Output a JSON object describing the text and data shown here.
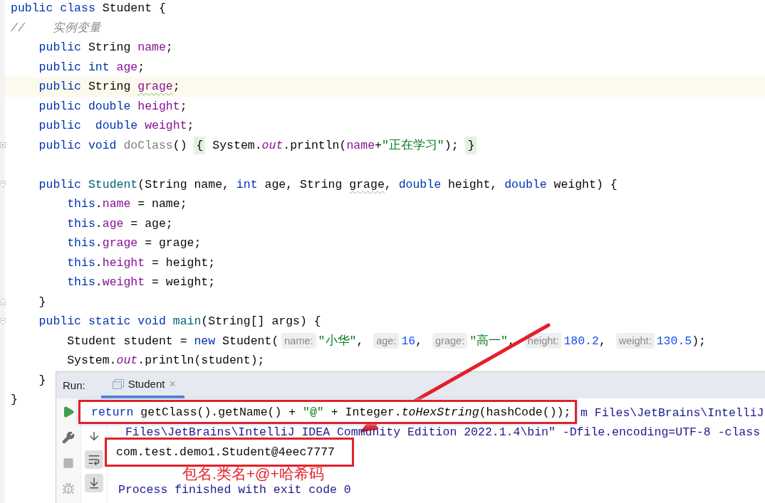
{
  "editor": {
    "lines": [
      {
        "kind": "plain",
        "highlighted": false,
        "tokens": [
          {
            "kind": "keyword",
            "text": "public class "
          },
          {
            "kind": "plain",
            "text": "Student {"
          }
        ]
      },
      {
        "kind": "plain",
        "highlighted": false,
        "tokens": [
          {
            "kind": "comment",
            "text": "//    实例变量"
          }
        ]
      },
      {
        "kind": "plain",
        "highlighted": false,
        "tokens": [
          {
            "kind": "keyword",
            "text": "    public "
          },
          {
            "kind": "plain",
            "text": "String "
          },
          {
            "kind": "field",
            "text": "name"
          },
          {
            "kind": "plain",
            "text": ";"
          }
        ]
      },
      {
        "kind": "plain",
        "highlighted": false,
        "tokens": [
          {
            "kind": "keyword",
            "text": "    public int "
          },
          {
            "kind": "field",
            "text": "age"
          },
          {
            "kind": "plain",
            "text": ";"
          }
        ]
      },
      {
        "kind": "plain",
        "highlighted": true,
        "tokens": [
          {
            "kind": "keyword",
            "text": "    public "
          },
          {
            "kind": "plain",
            "text": "String "
          },
          {
            "kind": "typo-field",
            "text": "grage"
          },
          {
            "kind": "plain",
            "text": ";"
          }
        ]
      },
      {
        "kind": "plain",
        "highlighted": false,
        "tokens": [
          {
            "kind": "keyword",
            "text": "    public double "
          },
          {
            "kind": "field",
            "text": "height"
          },
          {
            "kind": "plain",
            "text": ";"
          }
        ]
      },
      {
        "kind": "plain",
        "highlighted": false,
        "tokens": [
          {
            "kind": "keyword",
            "text": "    public  double "
          },
          {
            "kind": "field",
            "text": "weight"
          },
          {
            "kind": "plain",
            "text": ";"
          }
        ]
      },
      {
        "kind": "folded",
        "highlighted": false,
        "tokens": [
          {
            "kind": "keyword",
            "text": "    public void "
          },
          {
            "kind": "unused",
            "text": "doClass"
          },
          {
            "kind": "plain",
            "text": "() "
          },
          {
            "kind": "brace",
            "text": "{"
          },
          {
            "kind": "plain",
            "text": " System."
          },
          {
            "kind": "static",
            "text": "out"
          },
          {
            "kind": "plain",
            "text": ".println("
          },
          {
            "kind": "field",
            "text": "name"
          },
          {
            "kind": "plain",
            "text": "+"
          },
          {
            "kind": "string",
            "text": "\"正在学习\""
          },
          {
            "kind": "plain",
            "text": "); "
          },
          {
            "kind": "brace",
            "text": "}"
          }
        ]
      },
      {
        "kind": "plain",
        "highlighted": false
      },
      {
        "kind": "fold-start",
        "highlighted": false,
        "tokens": [
          {
            "kind": "keyword",
            "text": "    public "
          },
          {
            "kind": "declaration",
            "text": "Student"
          },
          {
            "kind": "plain",
            "text": "(String name, "
          },
          {
            "kind": "keyword",
            "text": "int"
          },
          {
            "kind": "plain",
            "text": " age, String "
          },
          {
            "kind": "typo",
            "text": "grage"
          },
          {
            "kind": "plain",
            "text": ", "
          },
          {
            "kind": "keyword",
            "text": "double"
          },
          {
            "kind": "plain",
            "text": " height, "
          },
          {
            "kind": "keyword",
            "text": "double"
          },
          {
            "kind": "plain",
            "text": " weight) {"
          }
        ]
      },
      {
        "kind": "plain",
        "highlighted": false,
        "tokens": [
          {
            "kind": "keyword",
            "text": "        this"
          },
          {
            "kind": "plain",
            "text": "."
          },
          {
            "kind": "field",
            "text": "name"
          },
          {
            "kind": "plain",
            "text": " = name;"
          }
        ]
      },
      {
        "kind": "plain",
        "highlighted": false,
        "tokens": [
          {
            "kind": "keyword",
            "text": "        this"
          },
          {
            "kind": "plain",
            "text": "."
          },
          {
            "kind": "field",
            "text": "age"
          },
          {
            "kind": "plain",
            "text": " = age;"
          }
        ]
      },
      {
        "kind": "plain",
        "highlighted": false,
        "tokens": [
          {
            "kind": "keyword",
            "text": "        this"
          },
          {
            "kind": "plain",
            "text": "."
          },
          {
            "kind": "field",
            "text": "grage"
          },
          {
            "kind": "plain",
            "text": " = grage;"
          }
        ]
      },
      {
        "kind": "plain",
        "highlighted": false,
        "tokens": [
          {
            "kind": "keyword",
            "text": "        this"
          },
          {
            "kind": "plain",
            "text": "."
          },
          {
            "kind": "field",
            "text": "height"
          },
          {
            "kind": "plain",
            "text": " = height;"
          }
        ]
      },
      {
        "kind": "plain",
        "highlighted": false,
        "tokens": [
          {
            "kind": "keyword",
            "text": "        this"
          },
          {
            "kind": "plain",
            "text": "."
          },
          {
            "kind": "field",
            "text": "weight"
          },
          {
            "kind": "plain",
            "text": " = weight;"
          }
        ]
      },
      {
        "kind": "fold-end",
        "highlighted": false,
        "tokens": [
          {
            "kind": "plain",
            "text": "    }"
          }
        ]
      },
      {
        "kind": "fold-start",
        "highlighted": false,
        "tokens": [
          {
            "kind": "keyword",
            "text": "    public static void "
          },
          {
            "kind": "declaration",
            "text": "main"
          },
          {
            "kind": "plain",
            "text": "(String[] args) {"
          }
        ]
      },
      {
        "kind": "plain",
        "highlighted": false,
        "tokens": [
          {
            "kind": "plain",
            "text": "        Student student = "
          },
          {
            "kind": "keyword",
            "text": "new"
          },
          {
            "kind": "plain",
            "text": " Student("
          },
          {
            "kind": "hint",
            "text": "name:"
          },
          {
            "kind": "string",
            "text": "\"小华\""
          },
          {
            "kind": "plain",
            "text": ", "
          },
          {
            "kind": "hint",
            "text": "age:"
          },
          {
            "kind": "number",
            "text": "16"
          },
          {
            "kind": "plain",
            "text": ", "
          },
          {
            "kind": "hint",
            "text": "grage:"
          },
          {
            "kind": "string",
            "text": "\"高一\""
          },
          {
            "kind": "plain",
            "text": ", "
          },
          {
            "kind": "hint",
            "text": "height:"
          },
          {
            "kind": "number",
            "text": "180.2"
          },
          {
            "kind": "plain",
            "text": ", "
          },
          {
            "kind": "hint",
            "text": "weight:"
          },
          {
            "kind": "number",
            "text": "130.5"
          },
          {
            "kind": "plain",
            "text": ");"
          }
        ]
      },
      {
        "kind": "plain",
        "highlighted": false,
        "tokens": [
          {
            "kind": "plain",
            "text": "        System."
          },
          {
            "kind": "static",
            "text": "out"
          },
          {
            "kind": "plain",
            "text": ".println(student);"
          }
        ]
      },
      {
        "kind": "plain",
        "highlighted": false,
        "tokens": [
          {
            "kind": "plain",
            "text": "    }"
          }
        ]
      },
      {
        "kind": "plain",
        "highlighted": false,
        "tokens": [
          {
            "kind": "plain",
            "text": "}"
          }
        ]
      }
    ]
  },
  "run_panel": {
    "label": "Run:",
    "tabs": [
      {
        "title": "Student",
        "close": "×",
        "selected": true
      }
    ],
    "toolbar": [
      {
        "kind": "play",
        "disabled": false
      },
      {
        "kind": "wrench",
        "disabled": false
      },
      {
        "kind": "stop",
        "disabled": true
      },
      {
        "kind": "bug",
        "disabled": true
      }
    ],
    "toolbar_2": [
      {
        "kind": "down",
        "selected": false
      },
      {
        "kind": "wrap",
        "selected": true
      },
      {
        "kind": "scroll-end",
        "selected": true
      }
    ],
    "console": [
      {
        "kind": "clipped",
        "text": "m Files\\JetBrains\\IntelliJ"
      },
      {
        "kind": "command",
        "text": " Files\\JetBrains\\IntelliJ IDEA Community Edition 2022.1.4\\bin\" -Dfile.encoding=UTF-8 -class"
      },
      {
        "kind": "output",
        "text": "com.test.demo1.Student@4eec7777"
      },
      {
        "kind": "system",
        "text": "Process finished with exit code 0"
      }
    ]
  },
  "popup": {
    "tokens": [
      {
        "kind": "keyword",
        "text": "return"
      },
      {
        "kind": "plain",
        "text": " getClass().getName() + "
      },
      {
        "kind": "string",
        "text": "\"@\""
      },
      {
        "kind": "plain",
        "text": " + Integer."
      },
      {
        "kind": "italic",
        "text": "toHexString"
      },
      {
        "kind": "plain",
        "text": "(hashCode());"
      }
    ]
  },
  "annotation": {
    "label": "包名.类名+@+哈希码"
  }
}
